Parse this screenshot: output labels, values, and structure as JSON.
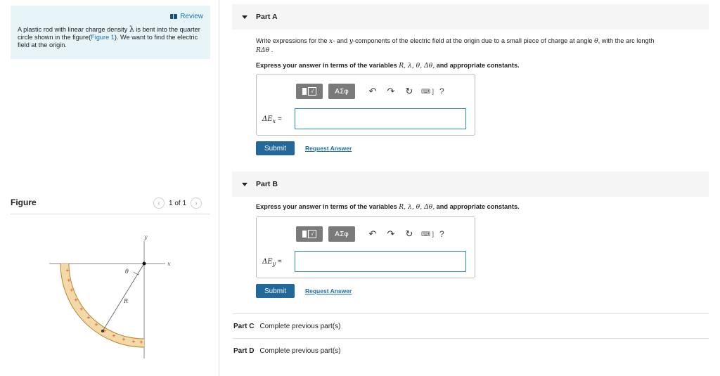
{
  "review": {
    "label": "Review",
    "icon": "book-icon"
  },
  "problem": {
    "text_before": "A plastic rod with linear charge density ",
    "lambda": "λ",
    "text_middle": " is bent into the quarter circle shown in the figure(",
    "figure_link": "Figure 1",
    "text_after": "). We want to find the electric field at the origin."
  },
  "figure": {
    "title": "Figure",
    "pager": "1 of 1",
    "labels": {
      "y": "y",
      "x": "x",
      "theta": "θ",
      "R": "R"
    }
  },
  "partA": {
    "title": "Part A",
    "instructions_1": "Write expressions for the ",
    "x_var": "x",
    "instructions_2": "- and ",
    "y_var": "y",
    "instructions_3": "-components of the electric field at the origin due to a small piece of charge at angle ",
    "theta": "θ",
    "instructions_4": ", with the arc length",
    "arc": "RΔθ",
    "instructions_5": " .",
    "express_text": "Express your answer in terms of the variables ",
    "vars": "R, λ, θ, Δθ,",
    "express_end": " and appropriate constants.",
    "field_label": "ΔE",
    "field_sub": "x",
    "equals": " =",
    "input_value": "",
    "submit_label": "Submit",
    "request_label": "Request Answer"
  },
  "partB": {
    "title": "Part B",
    "express_text": "Express your answer in terms of the variables ",
    "vars": "R, λ, θ, Δθ,",
    "express_end": " and appropriate constants.",
    "field_label": "ΔE",
    "field_sub": "y",
    "equals": " =",
    "input_value": "",
    "submit_label": "Submit",
    "request_label": "Request Answer"
  },
  "toolbar": {
    "greek_label": "ΑΣφ",
    "template_glyph": "√",
    "undo": "↶",
    "redo": "↷",
    "reset": "↻",
    "keyboard": "⌨ ]",
    "help": "?"
  },
  "partC": {
    "name": "Part C",
    "status": "Complete previous part(s)"
  },
  "partD": {
    "name": "Part D",
    "status": "Complete previous part(s)"
  }
}
